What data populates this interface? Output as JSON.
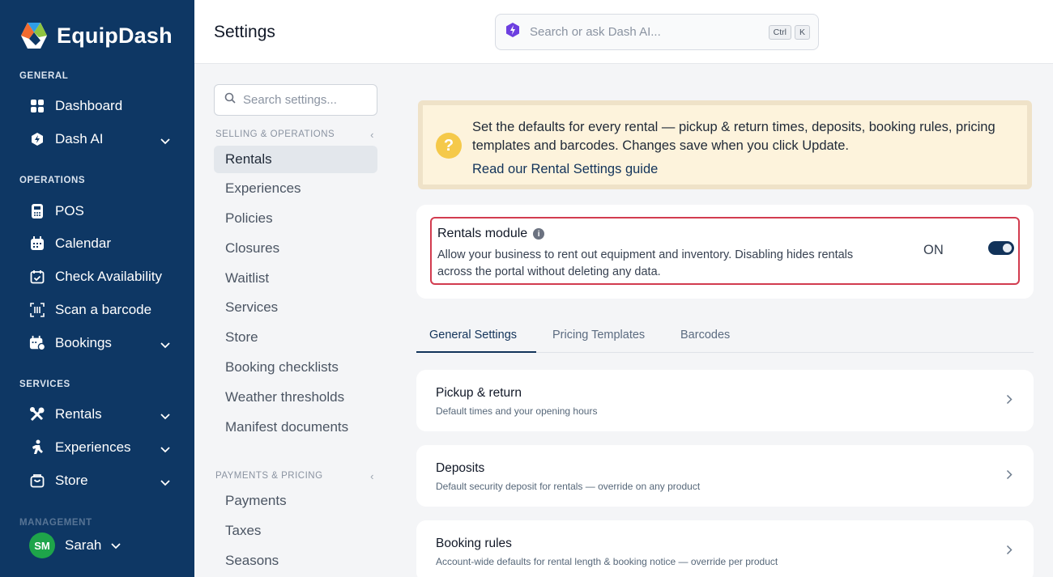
{
  "app": {
    "name": "EquipDash"
  },
  "sidebar": {
    "sections": {
      "general": "GENERAL",
      "operations": "OPERATIONS",
      "services": "SERVICES",
      "management": "MANAGEMENT"
    },
    "items": {
      "dashboard": "Dashboard",
      "dash_ai": "Dash AI",
      "pos": "POS",
      "calendar": "Calendar",
      "check_availability": "Check Availability",
      "scan_barcode": "Scan a barcode",
      "bookings": "Bookings",
      "rentals": "Rentals",
      "experiences": "Experiences",
      "store": "Store"
    },
    "user": {
      "initials": "SM",
      "name": "Sarah"
    }
  },
  "header": {
    "title": "Settings",
    "ai_search_placeholder": "Search or ask Dash AI...",
    "shortcut": [
      "Ctrl",
      "K"
    ]
  },
  "settings_nav": {
    "search_placeholder": "Search settings...",
    "section1": "SELLING & OPERATIONS",
    "section1_items": [
      "Rentals",
      "Experiences",
      "Policies",
      "Closures",
      "Waitlist",
      "Services",
      "Store",
      "Booking checklists",
      "Weather thresholds",
      "Manifest documents"
    ],
    "section2": "PAYMENTS & PRICING",
    "section2_items": [
      "Payments",
      "Taxes",
      "Seasons"
    ],
    "active": "Rentals"
  },
  "banner": {
    "message": "Set the defaults for every rental — pickup & return times, deposits, booking rules, pricing templates and barcodes. Changes save when you click Update.",
    "link": "Read our Rental Settings guide"
  },
  "module": {
    "title": "Rentals module",
    "description": "Allow your business to rent out equipment and inventory. Disabling hides rentals across the portal without deleting any data.",
    "state": "ON",
    "enabled": true
  },
  "tabs": [
    "General Settings",
    "Pricing Templates",
    "Barcodes"
  ],
  "active_tab": "General Settings",
  "rows": [
    {
      "title": "Pickup & return",
      "subtitle": "Default times and your opening hours"
    },
    {
      "title": "Deposits",
      "subtitle": "Default security deposit for rentals — override on any product"
    },
    {
      "title": "Booking rules",
      "subtitle": "Account-wide defaults for rental length & booking notice — override per product"
    }
  ],
  "colors": {
    "sidebar_bg": "#0e3764",
    "accent": "#12335a",
    "banner_bg": "#fdf3dc",
    "highlight_border": "#d23c4f",
    "avatar_green": "#1ea44a"
  }
}
